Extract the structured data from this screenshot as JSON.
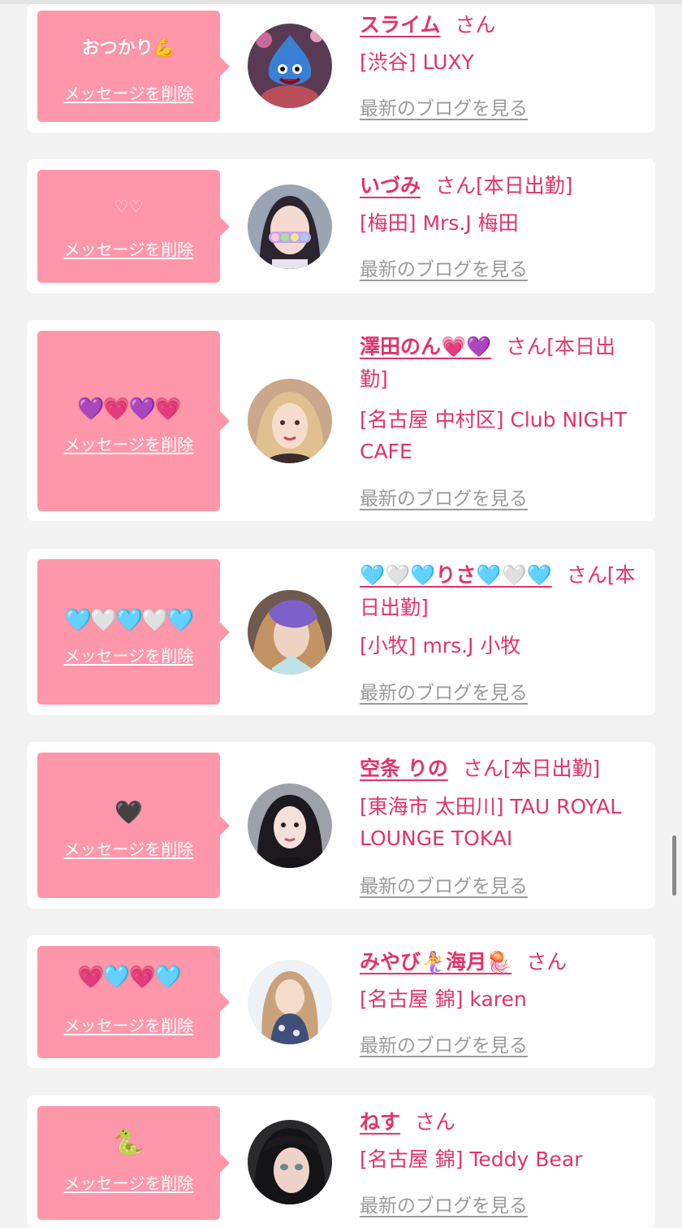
{
  "favorites": [
    {
      "message": "おつかり💪",
      "delete_label": "メッセージを削除",
      "name": "スライム",
      "honorific": "さん",
      "status": "",
      "shop": "[渋谷] LUXY",
      "blog_label": "最新のブログを見る"
    },
    {
      "message": "♡♡",
      "delete_label": "メッセージを削除",
      "name": "いづみ",
      "honorific": "さん",
      "status": "[本日出勤]",
      "shop": "[梅田] Mrs.J 梅田",
      "blog_label": "最新のブログを見る"
    },
    {
      "message": "💜💗💜💗",
      "delete_label": "メッセージを削除",
      "name": "澤田のん💗💜",
      "honorific": "さん",
      "status": "[本日出勤]",
      "shop": "[名古屋 中村区] Club NIGHT CAFE",
      "blog_label": "最新のブログを見る"
    },
    {
      "message": "🩵🤍🩵🤍🩵",
      "delete_label": "メッセージを削除",
      "name": "🩵🤍🩵りさ🩵🤍🩵",
      "honorific": "さん",
      "status": "[本日出勤]",
      "shop": "[小牧] mrs.J 小牧",
      "blog_label": "最新のブログを見る"
    },
    {
      "message": "🖤",
      "delete_label": "メッセージを削除",
      "name": "空条 りの",
      "honorific": "さん",
      "status": "[本日出勤]",
      "shop": "[東海市 太田川] TAU ROYAL LOUNGE TOKAI",
      "blog_label": "最新のブログを見る"
    },
    {
      "message": "💗🩵💗🩵",
      "delete_label": "メッセージを削除",
      "name": "みやび🧜‍♀️海月🪼",
      "honorific": "さん",
      "status": "",
      "shop": "[名古屋 錦] karen",
      "blog_label": "最新のブログを見る"
    },
    {
      "message": "🐍",
      "delete_label": "メッセージを削除",
      "name": "ねす",
      "honorific": "さん",
      "status": "",
      "shop": "[名古屋 錦] Teddy Bear",
      "blog_label": "最新のブログを見る"
    }
  ],
  "colors": {
    "accent_pink": "#e2336a",
    "message_box": "#ff97aa",
    "blog_link_gray": "#9a9a9a",
    "page_background": "#f2f2f2"
  }
}
